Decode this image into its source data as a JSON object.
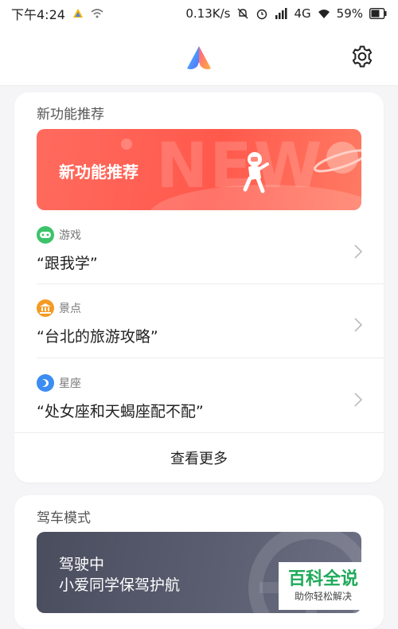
{
  "statusbar": {
    "time": "下午4:24",
    "speed": "0.13K/s",
    "network": "4G",
    "battery": "59%"
  },
  "header": {
    "logo": "xiaoai-logo",
    "settings_icon": "gear-icon"
  },
  "new_features": {
    "title": "新功能推荐",
    "banner": {
      "label": "新功能推荐",
      "art_text": "NEW"
    },
    "suggestions": [
      {
        "category": "游戏",
        "query": "“跟我学”",
        "icon": "gamepad-icon",
        "color": "#3cc36a"
      },
      {
        "category": "景点",
        "query": "“台北的旅游攻略”",
        "icon": "landmark-icon",
        "color": "#f59a23"
      },
      {
        "category": "星座",
        "query": "“处女座和天蝎座配不配”",
        "icon": "constellation-icon",
        "color": "#3b8df2"
      }
    ],
    "more_label": "查看更多"
  },
  "driving": {
    "title": "驾车模式",
    "line1": "驾驶中",
    "line2": "小爱同学保驾护航"
  },
  "watermark": {
    "main": "百科全说",
    "sub": "助你轻松解决"
  },
  "colors": {
    "accent_red": "#ff594c",
    "drive_bg": "#4a4d5e",
    "watermark_green": "#1faa5a"
  }
}
